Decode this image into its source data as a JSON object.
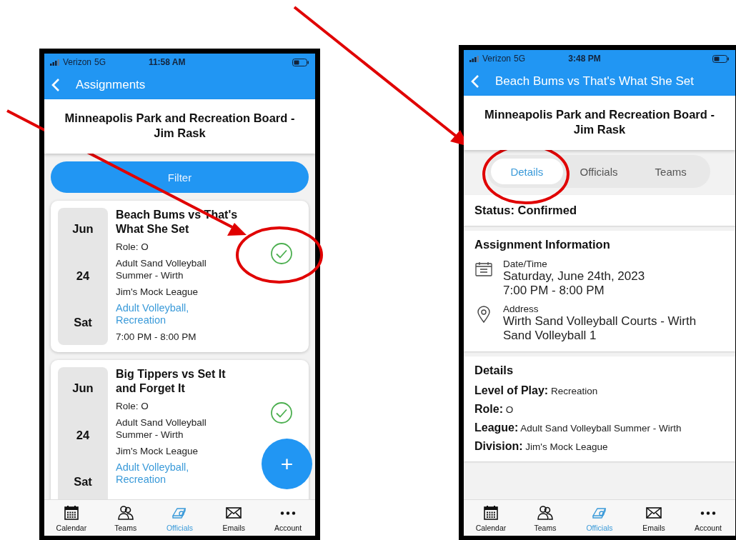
{
  "phones": [
    {
      "kind": "list",
      "status_bar": {
        "carrier": "Verizon",
        "network": "5G",
        "time": "11:58 AM"
      },
      "header": {
        "title": "Assignments"
      },
      "organization": "Minneapolis Park and Recreation Board - Jim Rask",
      "filter_button": "Filter",
      "assignments": [
        {
          "month": "Jun",
          "day": "24",
          "weekday": "Sat",
          "title": "Beach Bums vs That's What She Set",
          "role": "Role: O",
          "league": "Adult Sand Volleyball Summer - Wirth",
          "division": "Jim's Mock League",
          "tags": "Adult Volleyball, Recreation",
          "time": "7:00 PM - 8:00 PM",
          "confirmed": true
        },
        {
          "month": "Jun",
          "day": "24",
          "weekday": "Sat",
          "title": "Big Tippers vs Set It and Forget It",
          "role": "Role: O",
          "league": "Adult Sand Volleyball Summer - Wirth",
          "division": "Jim's Mock League",
          "tags": "Adult Volleyball, Recreation",
          "confirmed": true
        }
      ],
      "add_button": "+",
      "tab_bar": [
        {
          "kind": "calendar",
          "label": "Calendar",
          "selected": false
        },
        {
          "kind": "teams",
          "label": "Teams",
          "selected": false
        },
        {
          "kind": "whistle",
          "label": "Officials",
          "selected": true
        },
        {
          "kind": "mail",
          "label": "Emails",
          "selected": false
        },
        {
          "kind": "more",
          "label": "Account",
          "selected": false
        }
      ]
    },
    {
      "kind": "detail",
      "status_bar": {
        "carrier": "Verizon",
        "network": "5G",
        "time": "3:48 PM"
      },
      "header": {
        "title": "Beach Bums vs That's What She Set"
      },
      "organization": "Minneapolis Park and Recreation Board - Jim Rask",
      "segments": [
        {
          "label": "Details",
          "selected": true
        },
        {
          "label": "Officials",
          "selected": false
        },
        {
          "label": "Teams",
          "selected": false
        }
      ],
      "status": "Status: Confirmed",
      "assignment_info": {
        "heading": "Assignment Information",
        "items": [
          {
            "kind": "calendar",
            "label": "Date/Time",
            "lines": [
              "Saturday, June 24th, 2023",
              "7:00 PM - 8:00 PM"
            ]
          },
          {
            "kind": "location",
            "label": "Address",
            "lines": [
              "Wirth Sand Volleyball Courts - Wirth Sand Volleyball 1"
            ]
          }
        ]
      },
      "details": {
        "heading": "Details",
        "fields": [
          "**Level of Play:** Recreation",
          "**Role:** O",
          "**League:** Adult Sand Volleyball Summer - Wirth",
          "**Division:** Jim's Mock League"
        ]
      },
      "tab_bar": [
        {
          "kind": "calendar",
          "label": "Calendar",
          "selected": false
        },
        {
          "kind": "teams",
          "label": "Teams",
          "selected": false
        },
        {
          "kind": "whistle",
          "label": "Officials",
          "selected": true
        },
        {
          "kind": "mail",
          "label": "Emails",
          "selected": false
        },
        {
          "kind": "more",
          "label": "Account",
          "selected": false
        }
      ]
    }
  ]
}
